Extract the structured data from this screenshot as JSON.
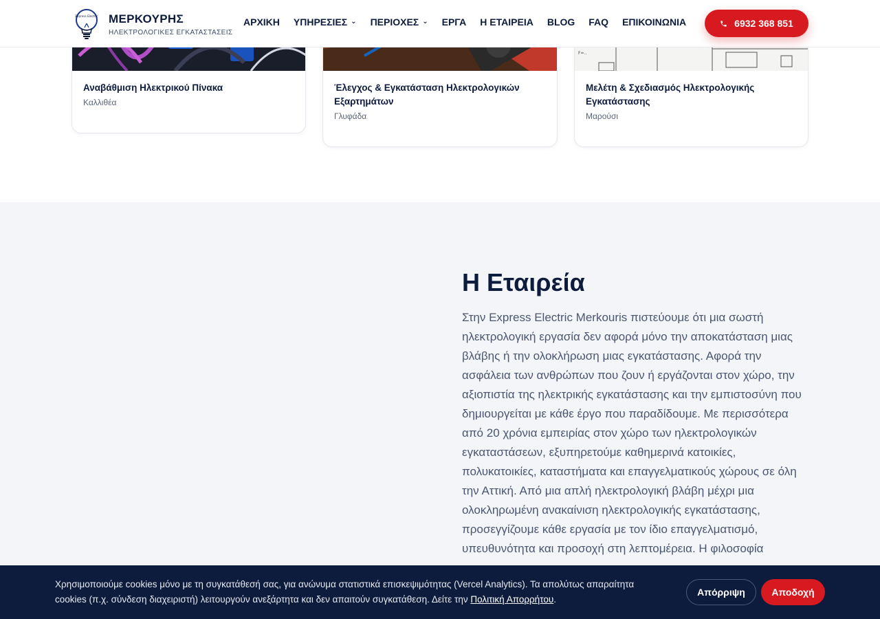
{
  "brand": {
    "name": "ΜΕΡΚΟΥΡΗΣ",
    "subtitle": "ΗΛΕΚΤΡΟΛΟΓΙΚΕΣ ΕΓΚΑΤΑΣΤΑΣΕΙΣ",
    "logo_text": "Express Electric"
  },
  "nav": {
    "items": [
      {
        "label": "ΑΡΧΙΚΗ",
        "dropdown": false
      },
      {
        "label": "ΥΠΗΡΕΣΙΕΣ",
        "dropdown": true
      },
      {
        "label": "ΠΕΡΙΟΧΕΣ",
        "dropdown": true
      },
      {
        "label": "ΕΡΓΑ",
        "dropdown": false
      },
      {
        "label": "Η ΕΤΑΙΡΕΙΑ",
        "dropdown": false
      },
      {
        "label": "BLOG",
        "dropdown": false
      },
      {
        "label": "FAQ",
        "dropdown": false
      },
      {
        "label": "ΕΠΙΚΟΙΝΩΝΙΑ",
        "dropdown": false
      }
    ],
    "phone": "6932 368 851"
  },
  "projects": [
    {
      "title": "Αναβάθμιση Ηλεκτρικού Πίνακα",
      "location": "Καλλιθέα",
      "image": "electrical-panel-cables"
    },
    {
      "title": "Έλεγχος & Εγκατάσταση Ηλεκτρολογικών Εξαρτημάτων",
      "location": "Γλυφάδα",
      "image": "multimeter"
    },
    {
      "title": "Μελέτη & Σχεδιασμός Ηλεκτρολογικής Εγκατάστασης",
      "location": "Μαρούσι",
      "image": "electrical-blueprint"
    }
  ],
  "company": {
    "title": "Η Εταιρεία",
    "text": "Στην Express Electric Merkouris πιστεύουμε ότι μια σωστή ηλεκτρολογική εργασία δεν αφορά μόνο την αποκατάσταση μιας βλάβης ή την ολοκλήρωση μιας εγκατάστασης. Αφορά την ασφάλεια των ανθρώπων που ζουν ή εργάζονται στον χώρο, την αξιοπιστία της ηλεκτρικής εγκατάστασης και την εμπιστοσύνη που δημιουργείται με κάθε έργο που παραδίδουμε. Με περισσότερα από 20 χρόνια εμπειρίας στον χώρο των ηλεκτρολογικών εγκαταστάσεων, εξυπηρετούμε καθημερινά κατοικίες, πολυκατοικίες, καταστήματα και επαγγελματικούς χώρους σε όλη την Αττική. Από μια απλή ηλεκτρολογική βλάβη μέχρι μια ολοκληρωμένη ανακαίνιση ηλεκτρολογικής εγκατάστασης, προσεγγίζουμε κάθε εργασία με τον ίδιο επαγγελματισμό, υπευθυνότητα και προσοχή στη λεπτομέρεια. Η φιλοσοφία"
  },
  "cookie": {
    "text": "Χρησιμοποιούμε cookies μόνο με τη συγκατάθεσή σας, για ανώνυμα στατιστικά επισκεψιμότητας (Vercel Analytics). Τα απολύτως απαραίτητα cookies (π.χ. σύνδεση διαχειριστή) λειτουργούν ανεξάρτητα και δεν απαιτούν συγκατάθεση. Δείτε την ",
    "link": "Πολιτική Απορρήτου",
    "text_end": ".",
    "reject": "Απόρριψη",
    "accept": "Αποδοχή"
  },
  "colors": {
    "primary": "#0d1b3d",
    "accent": "#d71920",
    "section_bg": "#f3f5f9"
  }
}
